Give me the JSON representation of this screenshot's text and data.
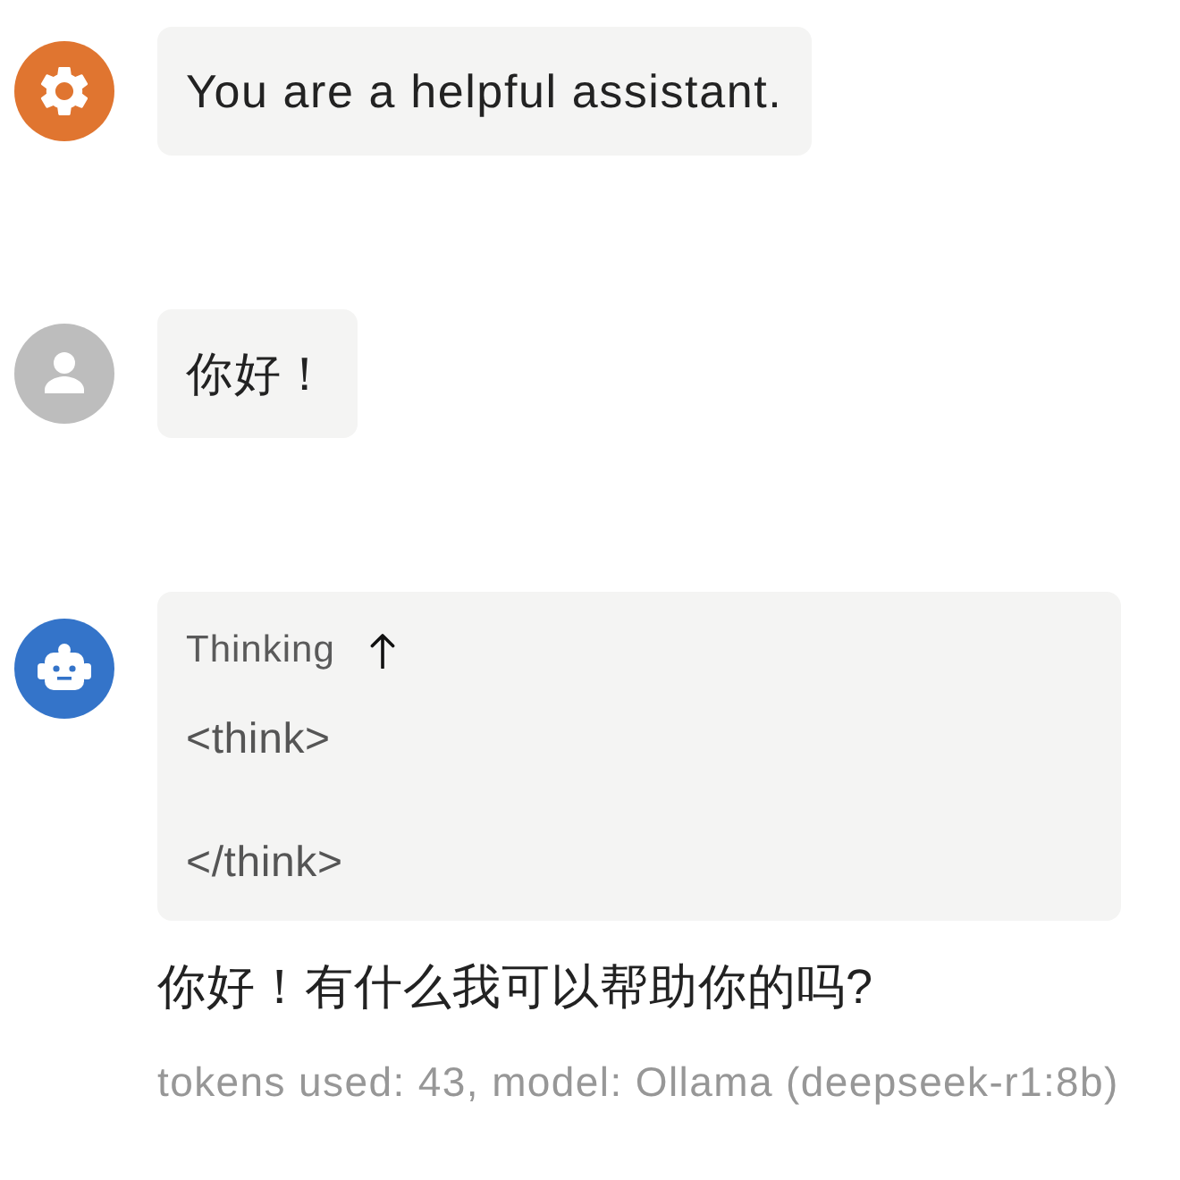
{
  "messages": [
    {
      "kind": "system",
      "text": "You are a helpful assistant."
    },
    {
      "kind": "user",
      "text": "你好！"
    },
    {
      "kind": "assistant",
      "thinking": {
        "label": "Thinking",
        "expanded": true,
        "lines": [
          "<think>",
          "</think>"
        ]
      },
      "text": "你好！有什么我可以帮助你的吗?",
      "meta": "tokens used: 43, model: Ollama (deepseek-r1:8b)"
    }
  ]
}
